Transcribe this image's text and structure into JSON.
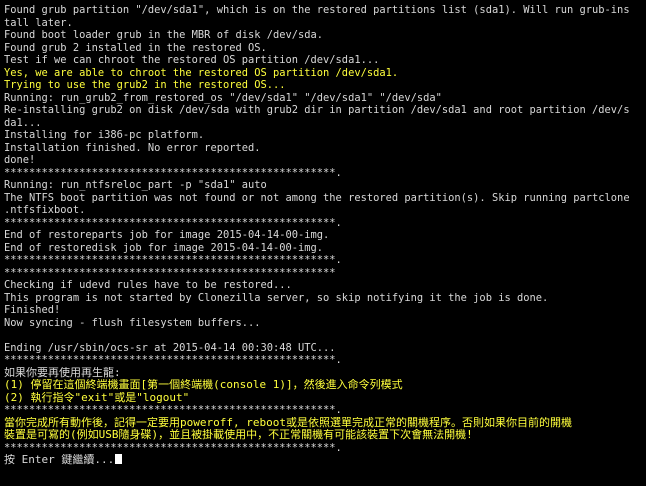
{
  "colors": {
    "background": "#000000",
    "text": "#d8d8d8",
    "highlight": "#ffff3c",
    "cursor": "#ffffff"
  },
  "terminal": {
    "lines": [
      {
        "text": "Found grub partition \"/dev/sda1\", which is on the restored partitions list (sda1). Will run grub-ins",
        "color": "normal"
      },
      {
        "text": "tall later.",
        "color": "normal"
      },
      {
        "text": "Found boot loader grub in the MBR of disk /dev/sda.",
        "color": "normal"
      },
      {
        "text": "Found grub 2 installed in the restored OS.",
        "color": "normal"
      },
      {
        "text": "Test if we can chroot the restored OS partition /dev/sda1...",
        "color": "normal"
      },
      {
        "text": "Yes, we are able to chroot the restored OS partition /dev/sda1.",
        "color": "yellow"
      },
      {
        "text": "Trying to use the grub2 in the restored OS...",
        "color": "yellow"
      },
      {
        "text": "Running: run_grub2_from_restored_os \"/dev/sda1\" \"/dev/sda1\" \"/dev/sda\"",
        "color": "normal"
      },
      {
        "text": "Re-installing grub2 on disk /dev/sda with grub2 dir in partition /dev/sda1 and root partition /dev/s",
        "color": "normal"
      },
      {
        "text": "da1...",
        "color": "normal"
      },
      {
        "text": "Installing for i386-pc platform.",
        "color": "normal"
      },
      {
        "text": "Installation finished. No error reported.",
        "color": "normal"
      },
      {
        "text": "done!",
        "color": "normal"
      },
      {
        "text": "*****************************************************.",
        "color": "normal"
      },
      {
        "text": "Running: run_ntfsreloc_part -p \"sda1\" auto",
        "color": "normal"
      },
      {
        "text": "The NTFS boot partition was not found or not among the restored partition(s). Skip running partclone",
        "color": "normal"
      },
      {
        "text": ".ntfsfixboot.",
        "color": "normal"
      },
      {
        "text": "*****************************************************.",
        "color": "normal"
      },
      {
        "text": "End of restoreparts job for image 2015-04-14-00-img.",
        "color": "normal"
      },
      {
        "text": "End of restoredisk job for image 2015-04-14-00-img.",
        "color": "normal"
      },
      {
        "text": "*****************************************************.",
        "color": "normal"
      },
      {
        "text": "*****************************************************",
        "color": "normal"
      },
      {
        "text": "Checking if udevd rules have to be restored...",
        "color": "normal"
      },
      {
        "text": "This program is not started by Clonezilla server, so skip notifying it the job is done.",
        "color": "normal"
      },
      {
        "text": "Finished!",
        "color": "normal"
      },
      {
        "text": "Now syncing - flush filesystem buffers...",
        "color": "normal"
      },
      {
        "text": "",
        "color": "normal"
      },
      {
        "text": "Ending /usr/sbin/ocs-sr at 2015-04-14 00:30:48 UTC...",
        "color": "normal"
      },
      {
        "text": "*****************************************************.",
        "color": "normal"
      },
      {
        "text": "如果你要再使用再生龍:",
        "color": "normal"
      },
      {
        "text": "(1) 停留在這個終端機畫面[第一個終端機(console 1)]，然後進入命令列模式",
        "color": "yellow"
      },
      {
        "text": "(2) 執行指令\"exit\"或是\"logout\"",
        "color": "yellow"
      },
      {
        "text": "*****************************************************.",
        "color": "normal"
      },
      {
        "text": "當你完成所有動作後，記得一定要用poweroff, reboot或是依照選單完成正常的關機程序。否則如果你目前的開機",
        "color": "yellow"
      },
      {
        "text": "裝置是可寫的(例如USB隨身碟)，並且被掛載使用中，不正常關機有可能該裝置下次會無法開機!",
        "color": "yellow"
      },
      {
        "text": "*****************************************************.",
        "color": "normal"
      }
    ],
    "prompt": "按 Enter 鍵繼續..."
  }
}
